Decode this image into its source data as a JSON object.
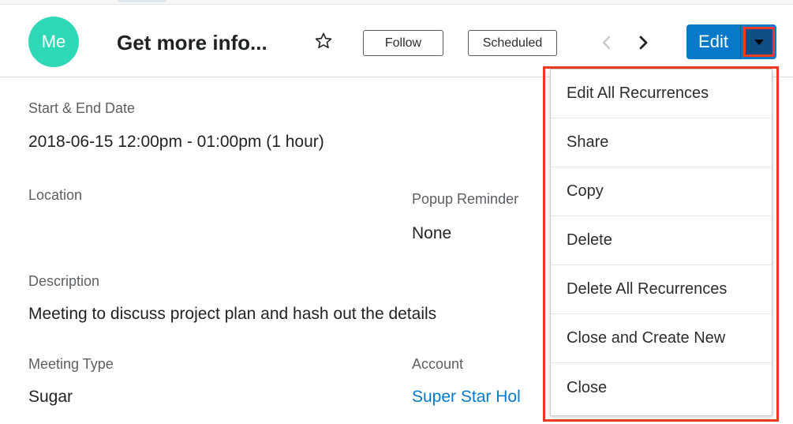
{
  "header": {
    "avatar_initials": "Me",
    "record_title": "Get more info...",
    "follow_label": "Follow",
    "status_label": "Scheduled",
    "edit_label": "Edit",
    "accent_color": "#0679c8",
    "avatar_color": "#2ed8b6"
  },
  "fields": {
    "start_end_label": "Start & End Date",
    "start_end_value": "2018-06-15 12:00pm - 01:00pm (1 hour)",
    "location_label": "Location",
    "popup_label": "Popup Reminder",
    "popup_value": "None",
    "description_label": "Description",
    "description_value": "Meeting to discuss project plan and hash out the details",
    "meeting_type_label": "Meeting Type",
    "meeting_type_value": "Sugar",
    "account_label": "Account",
    "account_value": "Super Star Hol"
  },
  "menu": {
    "items": [
      "Edit All Recurrences",
      "Share",
      "Copy",
      "Delete",
      "Delete All Recurrences",
      "Close and Create New",
      "Close"
    ]
  },
  "highlight_color": "#ee3a20"
}
